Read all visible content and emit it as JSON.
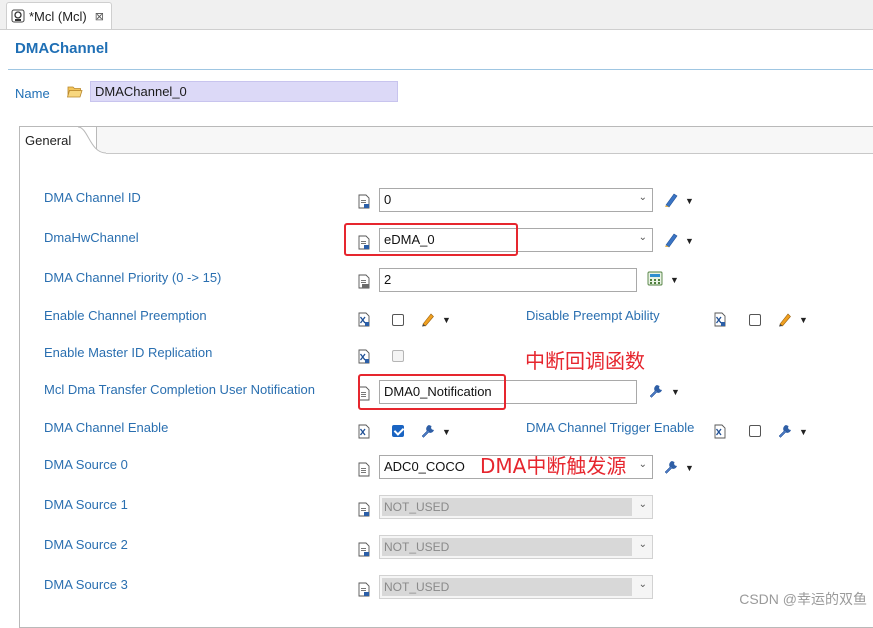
{
  "editor_tab": {
    "title": "*Mcl (Mcl)",
    "close": "⊠"
  },
  "page_title": "DMAChannel",
  "name_field": {
    "label": "Name",
    "value": "DMAChannel_0"
  },
  "tabs": [
    {
      "label": "General"
    }
  ],
  "rows": {
    "channel_id": {
      "label": "DMA Channel ID",
      "value": "0"
    },
    "hw_channel": {
      "label": "DmaHwChannel",
      "value": "eDMA_0"
    },
    "priority": {
      "label": "DMA Channel Priority (0 -> 15)",
      "value": "2"
    },
    "preemption": {
      "label": "Enable Channel Preemption",
      "checked": false
    },
    "disable_preempt": {
      "label": "Disable Preempt Ability",
      "checked": false
    },
    "master_id": {
      "label": "Enable Master ID Replication",
      "checked": false
    },
    "notification": {
      "label": "Mcl Dma Transfer Completion User Notification",
      "value": "DMA0_Notification"
    },
    "channel_enable": {
      "label": "DMA Channel Enable",
      "checked": true
    },
    "trigger_enable": {
      "label": "DMA Channel Trigger Enable",
      "checked": false
    },
    "source0": {
      "label": "DMA Source 0",
      "value": "ADC0_COCO"
    },
    "source1": {
      "label": "DMA Source 1",
      "value": "NOT_USED"
    },
    "source2": {
      "label": "DMA Source 2",
      "value": "NOT_USED"
    },
    "source3": {
      "label": "DMA Source 3",
      "value": "NOT_USED"
    }
  },
  "annotations": {
    "callback": "中断回调函数",
    "trigger_source": "DMA中断触发源"
  },
  "watermark": "CSDN @幸运的双鱼",
  "colors": {
    "label_blue": "#1f6fb5",
    "annotation_red": "#e6262e",
    "name_field_bg": "#dcd9f7",
    "checkbox_blue": "#1a64c2"
  }
}
